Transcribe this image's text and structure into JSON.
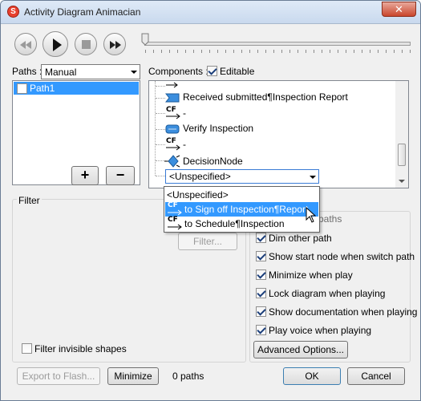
{
  "window": {
    "title": "Activity Diagram Animacian",
    "close_glyph": "✕"
  },
  "paths": {
    "label": "Paths :",
    "mode_value": "Manual",
    "items": [
      {
        "name": "Path1",
        "checked": false
      }
    ],
    "add_glyph": "+",
    "remove_glyph": "−"
  },
  "components": {
    "label": "Components :",
    "editable_label": "Editable",
    "editable_checked": true,
    "tree": [
      {
        "type": "arrow",
        "label": ""
      },
      {
        "type": "action",
        "label": "Received submitted¶Inspection Report"
      },
      {
        "type": "cf",
        "label": "-"
      },
      {
        "type": "action",
        "label": "Verify Inspection"
      },
      {
        "type": "cf",
        "label": "-"
      },
      {
        "type": "decision",
        "label": "DecisionNode"
      }
    ],
    "combo_value": "<Unspecified>",
    "dropdown_options": [
      {
        "label": "<Unspecified>",
        "icon": "",
        "selected": false
      },
      {
        "label": "to Sign off Inspection¶Report",
        "icon": "CF",
        "selected": true
      },
      {
        "label": "to Schedule¶Inspection",
        "icon": "CF",
        "selected": false
      }
    ]
  },
  "filter": {
    "title": "Filter",
    "filter_button": "Filter...",
    "filter_invisible_label": "Filter invisible shapes"
  },
  "options": {
    "partial_label": "paths",
    "items": [
      {
        "label": "Dim other path",
        "checked": true
      },
      {
        "label": "Show start node when switch path",
        "checked": true
      },
      {
        "label": "Minimize when play",
        "checked": true
      },
      {
        "label": "Lock diagram when playing",
        "checked": true
      },
      {
        "label": "Show documentation when playing",
        "checked": true
      },
      {
        "label": "Play voice when playing",
        "checked": true
      }
    ],
    "advanced_button": "Advanced Options..."
  },
  "bottom": {
    "export_button": "Export to Flash...",
    "minimize_button": "Minimize",
    "paths_count": "0 paths",
    "ok_button": "OK",
    "cancel_button": "Cancel"
  }
}
